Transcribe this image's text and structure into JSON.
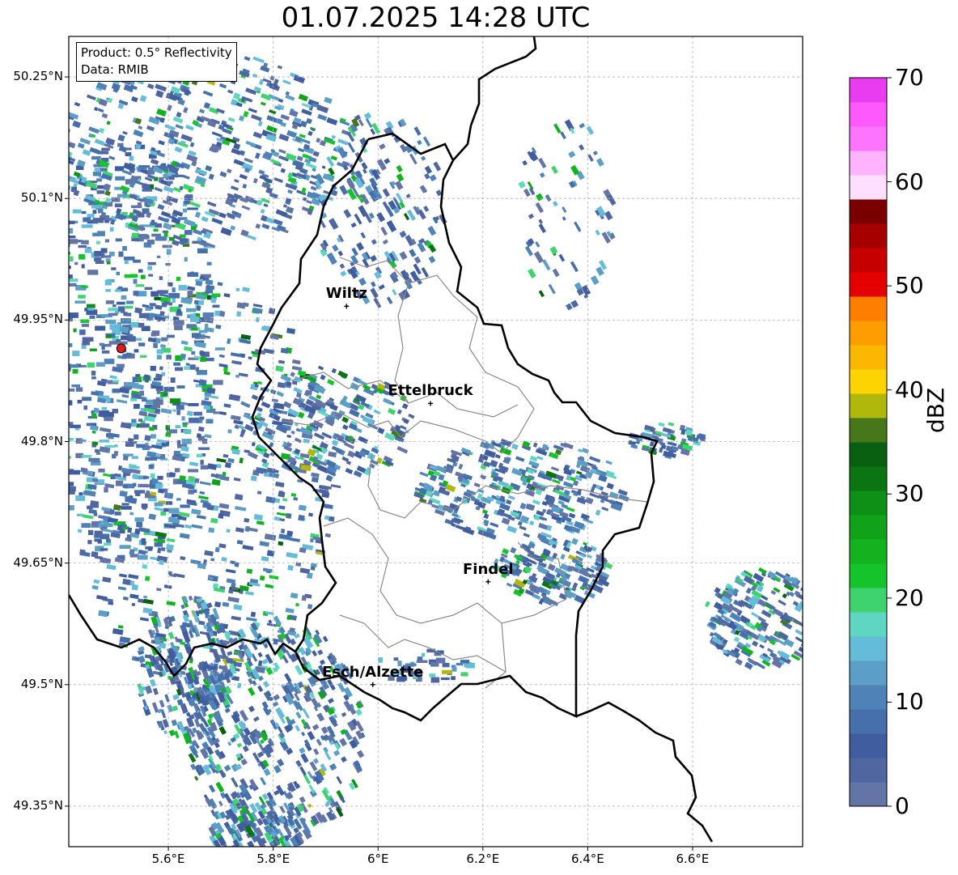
{
  "title": "01.07.2025 14:28 UTC",
  "info_box": {
    "product": "Product: 0.5° Reflectivity",
    "data": "Data: RMIB"
  },
  "map": {
    "lon_range": [
      5.41,
      6.81
    ],
    "lat_range": [
      49.3,
      50.3
    ],
    "lat_ticks": [
      {
        "value": 50.25,
        "label": "50.25°N"
      },
      {
        "value": 50.1,
        "label": "50.1°N"
      },
      {
        "value": 49.95,
        "label": "49.95°N"
      },
      {
        "value": 49.8,
        "label": "49.8°N"
      },
      {
        "value": 49.65,
        "label": "49.65°N"
      },
      {
        "value": 49.5,
        "label": "49.5°N"
      },
      {
        "value": 49.35,
        "label": "49.35°N"
      }
    ],
    "lon_ticks": [
      {
        "value": 5.6,
        "label": "5.6°E"
      },
      {
        "value": 5.8,
        "label": "5.8°E"
      },
      {
        "value": 6.0,
        "label": "6°E"
      },
      {
        "value": 6.2,
        "label": "6.2°E"
      },
      {
        "value": 6.4,
        "label": "6.4°E"
      },
      {
        "value": 6.6,
        "label": "6.6°E"
      }
    ],
    "cities": [
      {
        "name": "Wiltz",
        "lon": 5.94,
        "lat": 49.967
      },
      {
        "name": "Ettelbruck",
        "lon": 6.1,
        "lat": 49.847
      },
      {
        "name": "Findel",
        "lon": 6.21,
        "lat": 49.627
      },
      {
        "name": "Esch/Alzette",
        "lon": 5.99,
        "lat": 49.5
      }
    ],
    "radar_site": {
      "lon": 5.51,
      "lat": 49.915,
      "color": "#e31a1c"
    }
  },
  "colorbar": {
    "label": "dBZ",
    "min": 0,
    "max": 70,
    "ticks": [
      "0",
      "10",
      "20",
      "30",
      "40",
      "50",
      "60",
      "70"
    ],
    "colors": [
      "#6375a7",
      "#4f66a1",
      "#405e9f",
      "#466fab",
      "#4f83b8",
      "#5b9ec6",
      "#64bcd9",
      "#5ed6c2",
      "#3ed36e",
      "#14c42a",
      "#12b31f",
      "#10a31a",
      "#0e8f15",
      "#0b7611",
      "#096010",
      "#46771a",
      "#afb80b",
      "#fdd300",
      "#fcb800",
      "#fd9d00",
      "#fe7f00",
      "#e50000",
      "#c60000",
      "#a70000",
      "#7a0000",
      "#ffdefe",
      "#feb4fd",
      "#fe75fd",
      "#fd59fd",
      "#e93bf0"
    ]
  }
}
